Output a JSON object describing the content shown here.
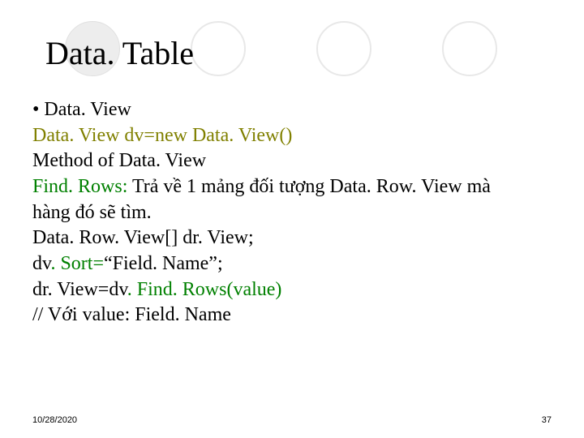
{
  "title": {
    "t1": "Data",
    "dot": ". ",
    "t2": "Table"
  },
  "body": {
    "l1_bullet": "• Data",
    "l1_rest": ". View",
    "l2_a": "Data",
    "l2_b": ". View dv=new Data",
    "l2_c": ". View()",
    "l3_a": "Method of Data",
    "l3_b": ". View",
    "l4_a": "Find",
    "l4_b": ". Rows:",
    "l4_c": "   Trả về 1 mảng đối tượng  Data",
    "l4_d": ". Row",
    "l4_e": ". View mà",
    "l5": "hàng đó sẽ tìm.",
    "l6_a": "Data",
    "l6_b": ". Row",
    "l6_c": ". View[] dr",
    "l6_d": ". View;",
    "l7_a": "dv",
    "l7_b": ". Sort=",
    "l7_c": "“Field",
    "l7_d": ". Name”;",
    "l8_a": "dr",
    "l8_b": ". View=dv",
    "l8_c": ". Find",
    "l8_d": ". Rows(value)",
    "l9_a": "// Với value: Field",
    "l9_b": ". Name"
  },
  "footer": {
    "date": "10/28/2020",
    "page": "37"
  }
}
